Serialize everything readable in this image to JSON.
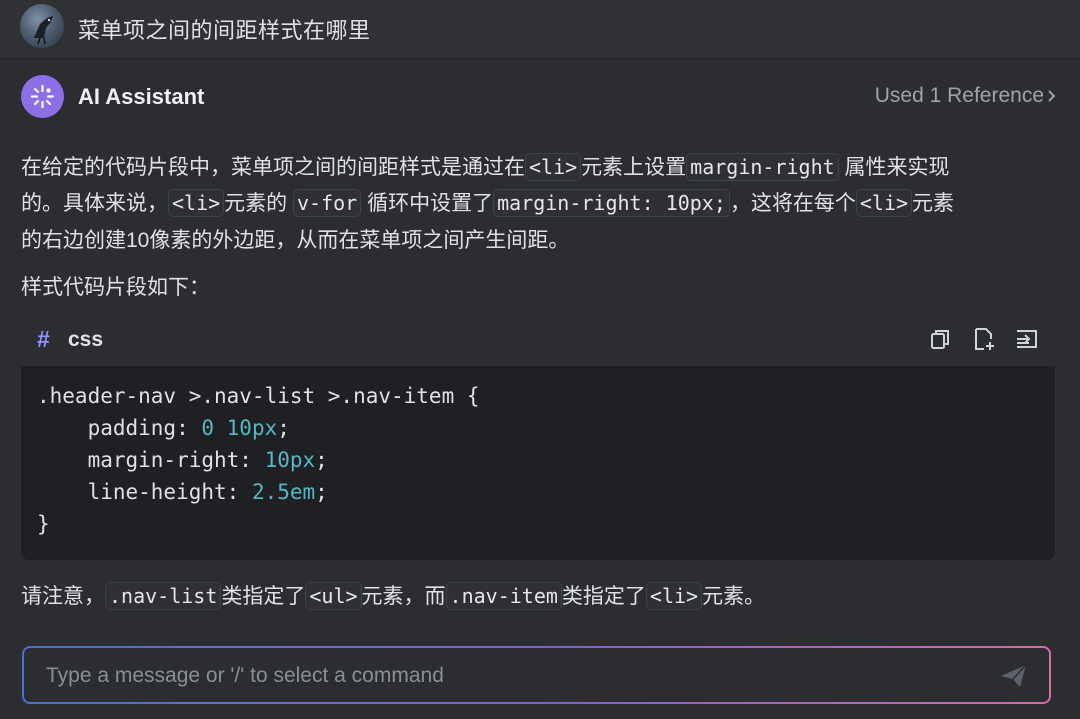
{
  "user": {
    "message": "菜单项之间的间距样式在哪里"
  },
  "assistant": {
    "name": "AI Assistant",
    "reference_label": "Used 1 Reference"
  },
  "answer": {
    "line1": {
      "a": "在给定的代码片段中，菜单项之间的间距样式是通过在",
      "c1": "<li>",
      "b": "元素上设置",
      "c2": "margin-right",
      "d": "属性来实现"
    },
    "line2": {
      "a": "的。具体来说，",
      "c1": "<li>",
      "b": "元素的",
      "c2": "v-for",
      "d": "循环中设置了",
      "c3": "margin-right: 10px;",
      "e": "，这将在每个",
      "c4": "<li>",
      "f": "元素"
    },
    "line3": "的右边创建10像素的外边距，从而在菜单项之间产生间距。",
    "line4": "样式代码片段如下：",
    "line5": {
      "a": "请注意，",
      "c1": ".nav-list",
      "b": "类指定了",
      "c2": "<ul>",
      "d": "元素，而",
      "c3": ".nav-item",
      "e": "类指定了",
      "c4": "<li>",
      "f": "元素。"
    }
  },
  "code": {
    "lang_hash": "#",
    "language": "css",
    "line1": ".header-nav >.nav-list >.nav-item {",
    "line2_prop": "    padding: ",
    "line2_val": "0 10px",
    "line3_prop": "    margin-right: ",
    "line3_val": "10px",
    "line4_prop": "    line-height: ",
    "line4_val": "2.5em",
    "line5": "}",
    "semicolon": ";"
  },
  "input": {
    "placeholder": "Type a message or '/' to select a command"
  },
  "colors": {
    "accent_purple": "#8c6ee6",
    "number_token": "#56b6c2",
    "background": "#2b2d30"
  },
  "icons": [
    "avatar-image",
    "ai-assistant-icon",
    "chevron-right-icon",
    "copy-icon",
    "insert-file-icon",
    "insert-at-caret-icon",
    "send-icon"
  ]
}
